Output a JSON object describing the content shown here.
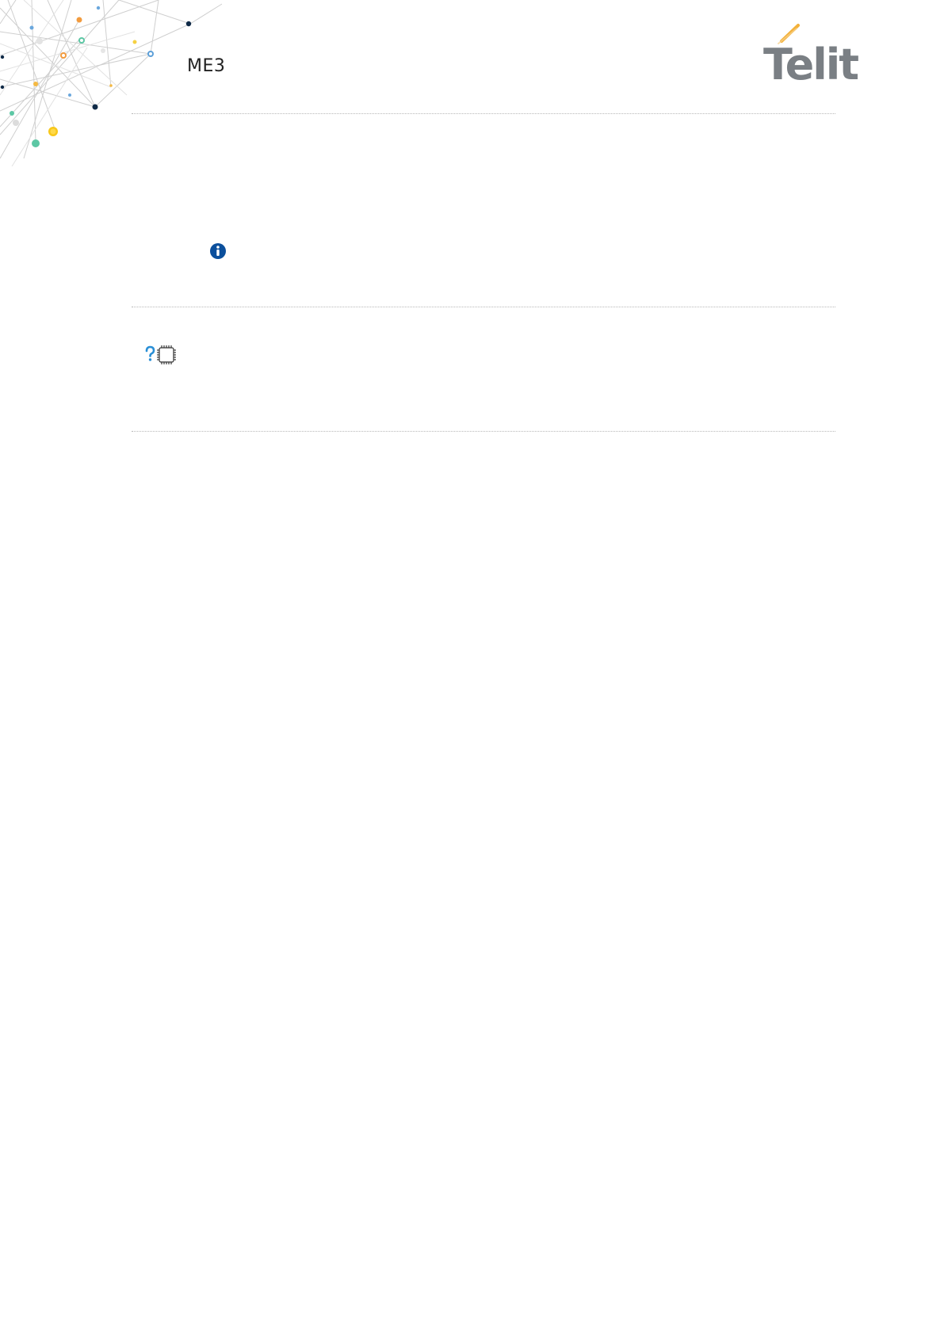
{
  "header": {
    "doc_title": "ME3",
    "logo_text": "Telit",
    "logo_name": "telit-logo"
  },
  "icons": {
    "info": "info-circle-icon",
    "help": "question-mark-icon",
    "chip": "chip-icon"
  },
  "colors": {
    "info_blue": "#0b4f9c",
    "help_blue": "#2a8fd6",
    "logo_gray": "#7a7f84",
    "logo_accent": "#f3b13a"
  }
}
